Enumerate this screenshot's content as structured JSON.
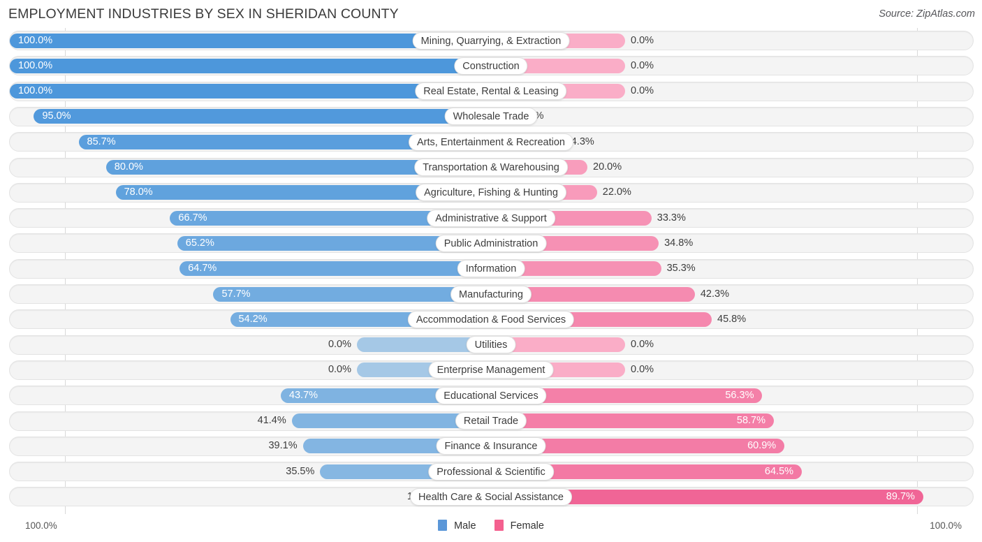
{
  "header": {
    "title": "EMPLOYMENT INDUSTRIES BY SEX IN SHERIDAN COUNTY",
    "source": "Source: ZipAtlas.com"
  },
  "legend": {
    "male_label": "Male",
    "female_label": "Female",
    "male_color": "#5b97d8",
    "female_color": "#f4608f"
  },
  "axis": {
    "left_max": "100.0%",
    "right_max": "100.0%"
  },
  "chart_data": {
    "type": "bar",
    "title": "EMPLOYMENT INDUSTRIES BY SEX IN SHERIDAN COUNTY",
    "subtitle": "Source: ZipAtlas.com",
    "orientation": "horizontal-diverging",
    "xlabel": "",
    "ylabel": "",
    "xlim": [
      0,
      100
    ],
    "grid": false,
    "legend_position": "bottom-center",
    "categories": [
      "Mining, Quarrying, & Extraction",
      "Construction",
      "Real Estate, Rental & Leasing",
      "Wholesale Trade",
      "Arts, Entertainment & Recreation",
      "Transportation & Warehousing",
      "Agriculture, Fishing & Hunting",
      "Administrative & Support",
      "Public Administration",
      "Information",
      "Manufacturing",
      "Accommodation & Food Services",
      "Utilities",
      "Enterprise Management",
      "Educational Services",
      "Retail Trade",
      "Finance & Insurance",
      "Professional & Scientific",
      "Health Care & Social Assistance"
    ],
    "series": [
      {
        "name": "Male",
        "values": [
          100.0,
          100.0,
          100.0,
          95.0,
          85.7,
          80.0,
          78.0,
          66.7,
          65.2,
          64.7,
          57.7,
          54.2,
          0.0,
          0.0,
          43.7,
          41.4,
          39.1,
          35.5,
          10.3
        ]
      },
      {
        "name": "Female",
        "values": [
          0.0,
          0.0,
          0.0,
          5.0,
          14.3,
          20.0,
          22.0,
          33.3,
          34.8,
          35.3,
          42.3,
          45.8,
          0.0,
          0.0,
          56.3,
          58.7,
          60.9,
          64.5,
          89.7
        ]
      }
    ]
  },
  "rows": [
    {
      "label": "Mining, Quarrying, & Extraction",
      "male": "100.0%",
      "female": "0.0%",
      "male_v": 100.0,
      "female_v": 0.0
    },
    {
      "label": "Construction",
      "male": "100.0%",
      "female": "0.0%",
      "male_v": 100.0,
      "female_v": 0.0
    },
    {
      "label": "Real Estate, Rental & Leasing",
      "male": "100.0%",
      "female": "0.0%",
      "male_v": 100.0,
      "female_v": 0.0
    },
    {
      "label": "Wholesale Trade",
      "male": "95.0%",
      "female": "5.0%",
      "male_v": 95.0,
      "female_v": 5.0
    },
    {
      "label": "Arts, Entertainment & Recreation",
      "male": "85.7%",
      "female": "14.3%",
      "male_v": 85.7,
      "female_v": 14.3
    },
    {
      "label": "Transportation & Warehousing",
      "male": "80.0%",
      "female": "20.0%",
      "male_v": 80.0,
      "female_v": 20.0
    },
    {
      "label": "Agriculture, Fishing & Hunting",
      "male": "78.0%",
      "female": "22.0%",
      "male_v": 78.0,
      "female_v": 22.0
    },
    {
      "label": "Administrative & Support",
      "male": "66.7%",
      "female": "33.3%",
      "male_v": 66.7,
      "female_v": 33.3
    },
    {
      "label": "Public Administration",
      "male": "65.2%",
      "female": "34.8%",
      "male_v": 65.2,
      "female_v": 34.8
    },
    {
      "label": "Information",
      "male": "64.7%",
      "female": "35.3%",
      "male_v": 64.7,
      "female_v": 35.3
    },
    {
      "label": "Manufacturing",
      "male": "57.7%",
      "female": "42.3%",
      "male_v": 57.7,
      "female_v": 42.3
    },
    {
      "label": "Accommodation & Food Services",
      "male": "54.2%",
      "female": "45.8%",
      "male_v": 54.2,
      "female_v": 45.8
    },
    {
      "label": "Utilities",
      "male": "0.0%",
      "female": "0.0%",
      "male_v": 0.0,
      "female_v": 0.0
    },
    {
      "label": "Enterprise Management",
      "male": "0.0%",
      "female": "0.0%",
      "male_v": 0.0,
      "female_v": 0.0
    },
    {
      "label": "Educational Services",
      "male": "43.7%",
      "female": "56.3%",
      "male_v": 43.7,
      "female_v": 56.3
    },
    {
      "label": "Retail Trade",
      "male": "41.4%",
      "female": "58.7%",
      "male_v": 41.4,
      "female_v": 58.7
    },
    {
      "label": "Finance & Insurance",
      "male": "39.1%",
      "female": "60.9%",
      "male_v": 39.1,
      "female_v": 60.9
    },
    {
      "label": "Professional & Scientific",
      "male": "35.5%",
      "female": "64.5%",
      "male_v": 35.5,
      "female_v": 64.5
    },
    {
      "label": "Health Care & Social Assistance",
      "male": "10.3%",
      "female": "89.7%",
      "male_v": 10.3,
      "female_v": 89.7
    }
  ]
}
